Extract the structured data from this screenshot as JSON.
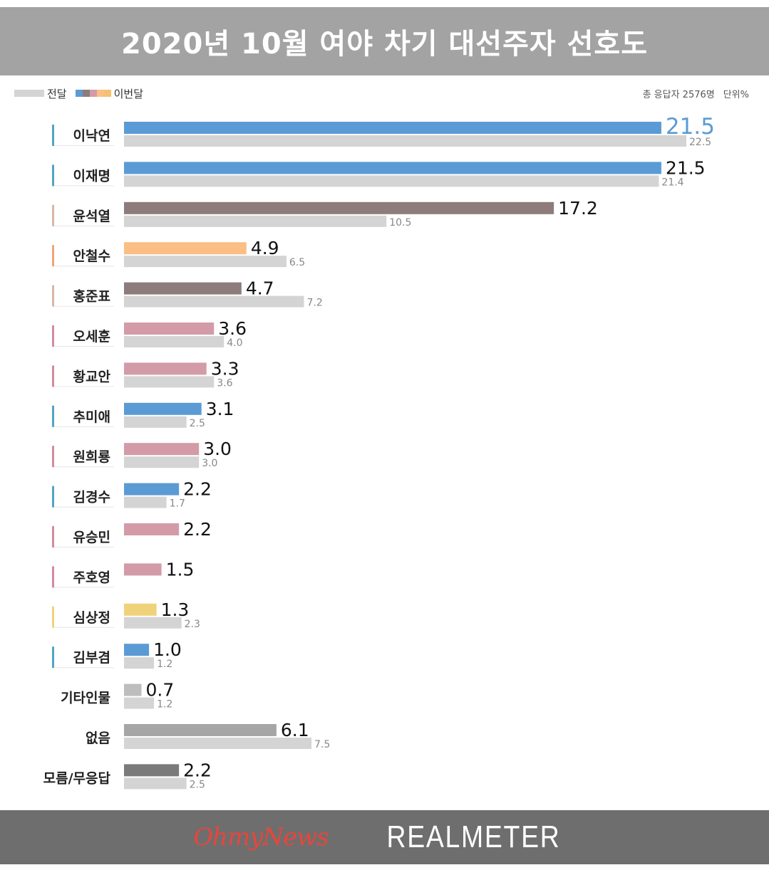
{
  "title": "2020년 10월 여야 차기 대선주자 선호도",
  "legend": {
    "previous_label": "전달",
    "current_label": "이번달",
    "current_swatch_colors": [
      "#5b9bd5",
      "#8e7b7b",
      "#d39ba7",
      "#fbbe84",
      "#f5c16e"
    ],
    "previous_color": "#d4d4d4"
  },
  "respondents_label": "총 응답자 2576명",
  "unit_label": "단위%",
  "footer": {
    "logo_left": "OhmyNews",
    "logo_right": "REALMETER"
  },
  "chart_data": {
    "type": "bar",
    "orientation": "horizontal",
    "xlim": [
      0,
      22.5
    ],
    "categories": [
      "이낙연",
      "이재명",
      "윤석열",
      "안철수",
      "홍준표",
      "오세훈",
      "황교안",
      "추미애",
      "원희룡",
      "김경수",
      "유승민",
      "주호영",
      "심상정",
      "김부겸",
      "기타인물",
      "없음",
      "모름/무응답"
    ],
    "series": [
      {
        "name": "이번달",
        "values": [
          21.5,
          21.5,
          17.2,
          4.9,
          4.7,
          3.6,
          3.3,
          3.1,
          3.0,
          2.2,
          2.2,
          1.5,
          1.3,
          1.0,
          0.7,
          6.1,
          2.2
        ],
        "value_labels": [
          "21.5",
          "21.5",
          "17.2",
          "4.9",
          "4.7",
          "3.6",
          "3.3",
          "3.1",
          "3.0",
          "2.2",
          "2.2",
          "1.5",
          "1.3",
          "1.0",
          "0.7",
          "6.1",
          "2.2"
        ],
        "colors": [
          "#5b9bd5",
          "#5b9bd5",
          "#8e7b7b",
          "#fbbe84",
          "#8e7b7b",
          "#d39ba7",
          "#d39ba7",
          "#5b9bd5",
          "#d39ba7",
          "#5b9bd5",
          "#d39ba7",
          "#d39ba7",
          "#f0d27a",
          "#5b9bd5",
          "#bdbdbd",
          "#a6a6a6",
          "#7a7a7a"
        ]
      },
      {
        "name": "전달",
        "values": [
          22.5,
          21.4,
          10.5,
          6.5,
          7.2,
          4.0,
          3.6,
          2.5,
          3.0,
          1.7,
          null,
          null,
          2.3,
          1.2,
          1.2,
          7.5,
          2.5
        ],
        "value_labels": [
          "22.5",
          "21.4",
          "10.5",
          "6.5",
          "7.2",
          "4.0",
          "3.6",
          "2.5",
          "3.0",
          "1.7",
          "",
          "",
          "2.3",
          "1.2",
          "1.2",
          "7.5",
          "2.5"
        ],
        "color": "#d4d4d4"
      }
    ],
    "marker_colors": [
      "#4fa6c0",
      "#4fa6c0",
      "#d9b7a5",
      "#f0a575",
      "#d9b7a5",
      "#d38a9c",
      "#d38a9c",
      "#4fa6c0",
      "#d38a9c",
      "#4fa6c0",
      "#d38a9c",
      "#d38a9c",
      "#f0d27a",
      "#4fa6c0",
      null,
      null,
      null
    ],
    "highlight_first_label_color": "#5b9bd5"
  }
}
